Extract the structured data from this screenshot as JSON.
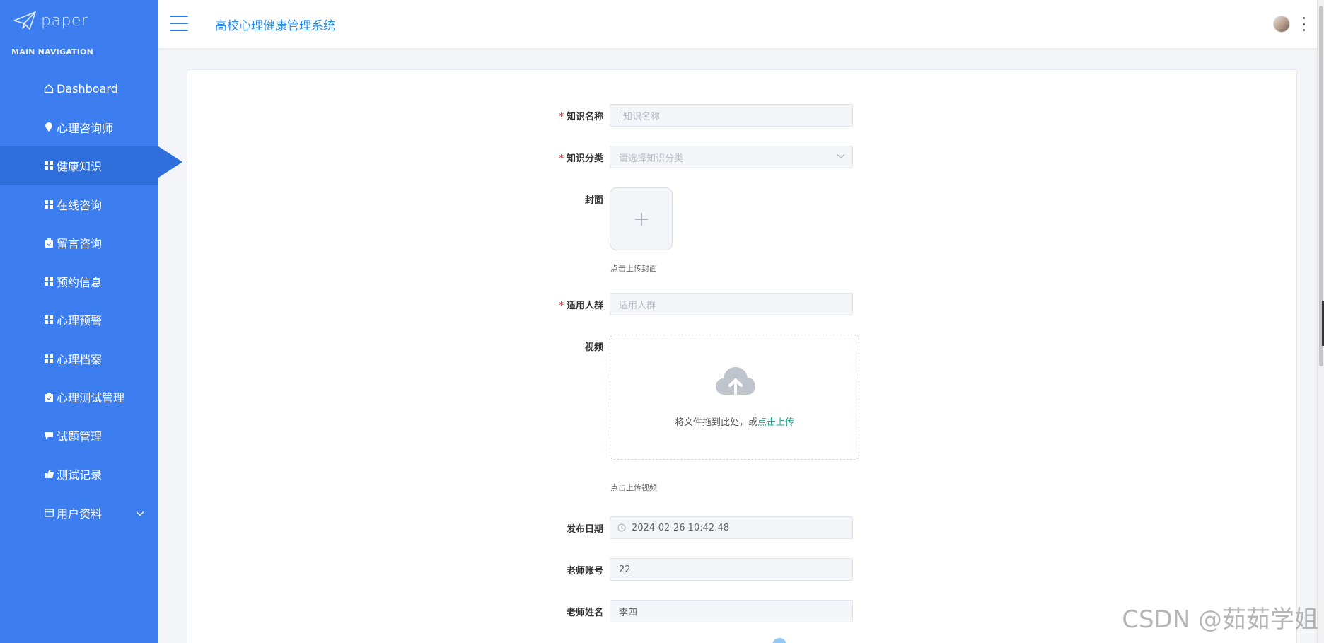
{
  "sidebar": {
    "logo_text": "paper",
    "heading": "MAIN NAVIGATION",
    "items": [
      {
        "label": "Dashboard",
        "icon": "home-icon"
      },
      {
        "label": "心理咨询师",
        "icon": "location-pin-icon"
      },
      {
        "label": "健康知识",
        "icon": "grid-icon",
        "active": true
      },
      {
        "label": "在线咨询",
        "icon": "grid-icon"
      },
      {
        "label": "留言咨询",
        "icon": "clipboard-icon"
      },
      {
        "label": "预约信息",
        "icon": "grid-icon"
      },
      {
        "label": "心理预警",
        "icon": "grid-icon"
      },
      {
        "label": "心理档案",
        "icon": "grid-icon"
      },
      {
        "label": "心理测试管理",
        "icon": "clipboard-icon"
      },
      {
        "label": "试题管理",
        "icon": "comment-icon"
      },
      {
        "label": "测试记录",
        "icon": "thumbs-up-icon"
      },
      {
        "label": "用户资料",
        "icon": "card-icon",
        "expandable": true
      }
    ]
  },
  "header": {
    "title": "高校心理健康管理系统"
  },
  "form": {
    "knowledge_name": {
      "label": "知识名称",
      "required": true,
      "placeholder": "知识名称",
      "value": ""
    },
    "knowledge_category": {
      "label": "知识分类",
      "required": true,
      "placeholder": "请选择知识分类",
      "value": ""
    },
    "cover": {
      "label": "封面",
      "hint": "点击上传封面"
    },
    "audience": {
      "label": "适用人群",
      "required": true,
      "placeholder": "适用人群",
      "value": ""
    },
    "video": {
      "label": "视频",
      "drag_text": "将文件拖到此处，或",
      "drag_link": "点击上传",
      "hint": "点击上传视频"
    },
    "publish_date": {
      "label": "发布日期",
      "value": "2024-02-26 10:42:48"
    },
    "teacher_account": {
      "label": "老师账号",
      "value": "22"
    },
    "teacher_name": {
      "label": "老师姓名",
      "value": "李四"
    }
  },
  "watermark": "CSDN @茹茹学姐",
  "colors": {
    "sidebar_bg": "#3c7ef0",
    "sidebar_active": "#2f6fdc",
    "accent": "#2b8ee6",
    "required": "#e24c4c",
    "link": "#2aa58b"
  }
}
